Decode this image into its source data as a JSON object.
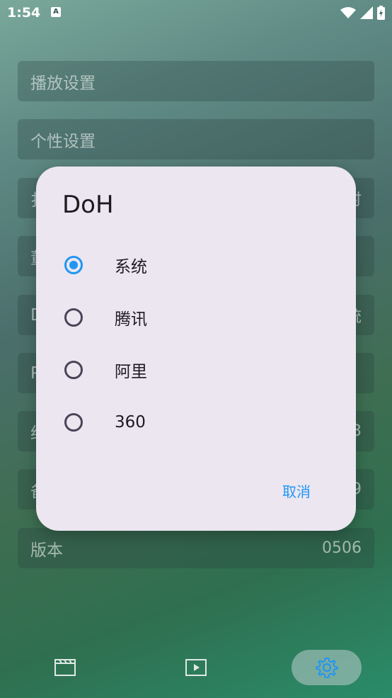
{
  "status_bar": {
    "time": "1:54",
    "notification_icon": "A"
  },
  "settings": {
    "rows": [
      {
        "label": "播放设置",
        "value": ""
      },
      {
        "label": "个性设置",
        "value": ""
      },
      {
        "label": "扌",
        "value": "时"
      },
      {
        "label": "董",
        "value": ""
      },
      {
        "label": "D",
        "value": "统"
      },
      {
        "label": "P",
        "value": ""
      },
      {
        "label": "约",
        "value": "3"
      },
      {
        "label": "备",
        "value": "9"
      },
      {
        "label": "版本",
        "value": "0506"
      }
    ]
  },
  "dialog": {
    "title": "DoH",
    "options": [
      {
        "label": "系统",
        "selected": true
      },
      {
        "label": "腾讯",
        "selected": false
      },
      {
        "label": "阿里",
        "selected": false
      },
      {
        "label": "360",
        "selected": false
      }
    ],
    "cancel_label": "取消"
  },
  "bottom_nav": {
    "items": [
      {
        "icon": "film-icon",
        "active": false
      },
      {
        "icon": "play-icon",
        "active": false
      },
      {
        "icon": "gear-icon",
        "active": true
      }
    ]
  },
  "colors": {
    "accent": "#2196f3",
    "dialog_bg": "#ece6f0"
  }
}
